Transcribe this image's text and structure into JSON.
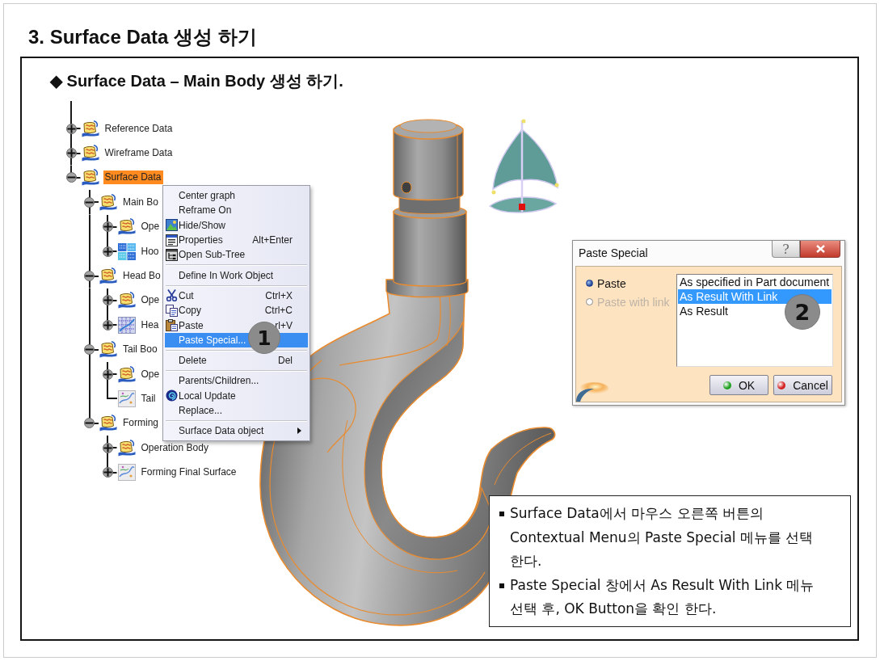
{
  "title": "3. Surface Data 생성 하기",
  "subtitle": "◆ Surface Data – Main Body 생성 하기.",
  "tree": {
    "items": [
      {
        "label": "Reference Data",
        "kind": "body",
        "expanded": false,
        "selected": false
      },
      {
        "label": "Wireframe Data",
        "kind": "body",
        "expanded": false,
        "selected": false
      },
      {
        "label": "Surface Data",
        "kind": "body",
        "expanded": true,
        "selected": true,
        "children": [
          {
            "label": "Main Bo",
            "kind": "body",
            "expanded": true,
            "selected": false,
            "children": [
              {
                "label": "Ope",
                "kind": "body",
                "expanded": false,
                "selected": false
              },
              {
                "label": "Hoo",
                "kind": "grid",
                "expanded": false,
                "selected": false
              }
            ]
          },
          {
            "label": "Head Bo",
            "kind": "body",
            "expanded": true,
            "selected": false,
            "children": [
              {
                "label": "Ope",
                "kind": "body",
                "expanded": false,
                "selected": false
              },
              {
                "label": "Hea",
                "kind": "mesh",
                "expanded": false,
                "selected": false
              }
            ]
          },
          {
            "label": "Tail Boo",
            "kind": "body",
            "expanded": true,
            "selected": false,
            "children": [
              {
                "label": "Ope",
                "kind": "body",
                "expanded": false,
                "selected": false
              },
              {
                "label": "Tail",
                "kind": "surface",
                "selected": false
              }
            ]
          },
          {
            "label": "Forming",
            "kind": "body",
            "expanded": true,
            "selected": false,
            "children": [
              {
                "label": "Operation Body",
                "kind": "body",
                "expanded": false,
                "selected": false
              },
              {
                "label": "Forming Final Surface",
                "kind": "surface",
                "expanded": false,
                "selected": false
              }
            ]
          }
        ]
      }
    ]
  },
  "context_menu": {
    "groups": [
      {
        "items": [
          {
            "label": "Center graph",
            "selected": false
          },
          {
            "label": "Reframe On",
            "selected": false
          },
          {
            "label": "Hide/Show",
            "selected": false
          },
          {
            "label": "Properties",
            "shortcut": "Alt+Enter",
            "selected": false
          },
          {
            "label": "Open Sub-Tree",
            "selected": false
          }
        ]
      },
      {
        "items": [
          {
            "label": "Define In Work Object",
            "selected": false
          }
        ]
      },
      {
        "items": [
          {
            "label": "Cut",
            "shortcut": "Ctrl+X",
            "selected": false
          },
          {
            "label": "Copy",
            "shortcut": "Ctrl+C",
            "selected": false
          },
          {
            "label": "Paste",
            "shortcut": "rl+V",
            "selected": false
          },
          {
            "label": "Paste Special...",
            "selected": true
          }
        ]
      },
      {
        "items": [
          {
            "label": "Delete",
            "shortcut": "Del",
            "selected": false
          }
        ]
      },
      {
        "items": [
          {
            "label": "Parents/Children...",
            "selected": false
          },
          {
            "label": "Local Update",
            "selected": false
          },
          {
            "label": "Replace...",
            "selected": false
          }
        ]
      },
      {
        "items": [
          {
            "label": "Surface Data object",
            "submenu": true,
            "selected": false
          }
        ]
      }
    ],
    "badge": "1"
  },
  "dialog": {
    "title": "Paste Special",
    "help_label": "?",
    "options": [
      {
        "label": "Paste",
        "selected": true,
        "disabled": false
      },
      {
        "label": "Paste with link",
        "selected": false,
        "disabled": true
      }
    ],
    "results": [
      {
        "label": "As specified in Part document",
        "selected": false
      },
      {
        "label": "As Result With Link",
        "selected": true
      },
      {
        "label": "As Result",
        "selected": false
      }
    ],
    "buttons": [
      {
        "label": "OK",
        "kind": "confirm"
      },
      {
        "label": "Cancel",
        "kind": "cancel"
      }
    ],
    "badge": "2"
  },
  "notes": [
    "Surface Data에서 마우스 오른쪽 버튼의 Contextual Menu의 Paste Special 메뉴를 선택 한다.",
    "Paste Special 창에서 As Result With Link 메뉴 선택 후, OK Button을 확인 한다."
  ]
}
